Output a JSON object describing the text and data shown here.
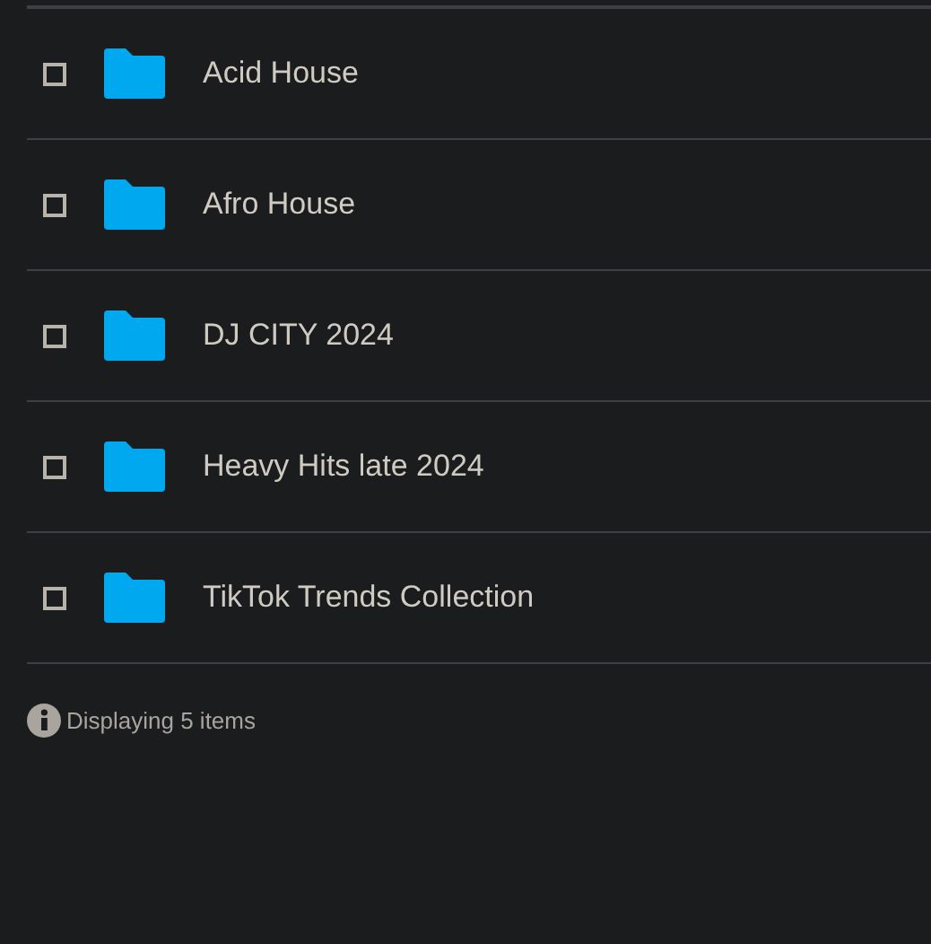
{
  "items": [
    {
      "name": "Acid House",
      "checked": false
    },
    {
      "name": "Afro House",
      "checked": false
    },
    {
      "name": "DJ CITY 2024",
      "checked": false
    },
    {
      "name": "Heavy Hits late 2024",
      "checked": false
    },
    {
      "name": "TikTok Trends Collection",
      "checked": false
    }
  ],
  "footer": {
    "text": "Displaying 5 items"
  }
}
